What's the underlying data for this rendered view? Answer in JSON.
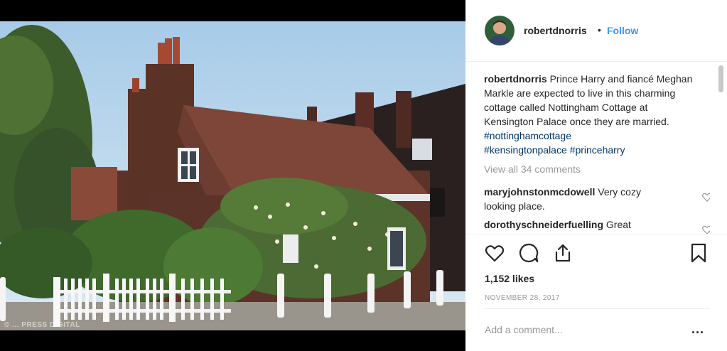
{
  "photo": {
    "watermark": "© ... PRESS DIGITAL"
  },
  "header": {
    "username": "robertdnorris",
    "separator": "•",
    "follow_label": "Follow"
  },
  "caption": {
    "username": "robertdnorris",
    "text": " Prince Harry and fiancé Meghan Markle are expected to live in this charming cottage called Nottingham Cottage at Kensington Palace once they are married. ",
    "hashtags": [
      "#nottinghamcottage",
      "#kensingtonpalace",
      "#princeharry"
    ]
  },
  "view_all_label": "View all 34 comments",
  "comments": [
    {
      "username": "maryjohnstonmcdowell",
      "text": " Very cozy looking place."
    },
    {
      "username": "dorothyschneiderfuelling",
      "text": " Great"
    }
  ],
  "likes": "1,152 likes",
  "date": "NOVEMBER 28, 2017",
  "add_comment_placeholder": "Add a comment...",
  "more_label": "...",
  "colors": {
    "link": "#3897f0",
    "hashtag": "#003569",
    "muted": "#999999",
    "text": "#262626"
  },
  "icons": [
    "heart-icon",
    "comment-icon",
    "share-icon",
    "bookmark-icon"
  ]
}
